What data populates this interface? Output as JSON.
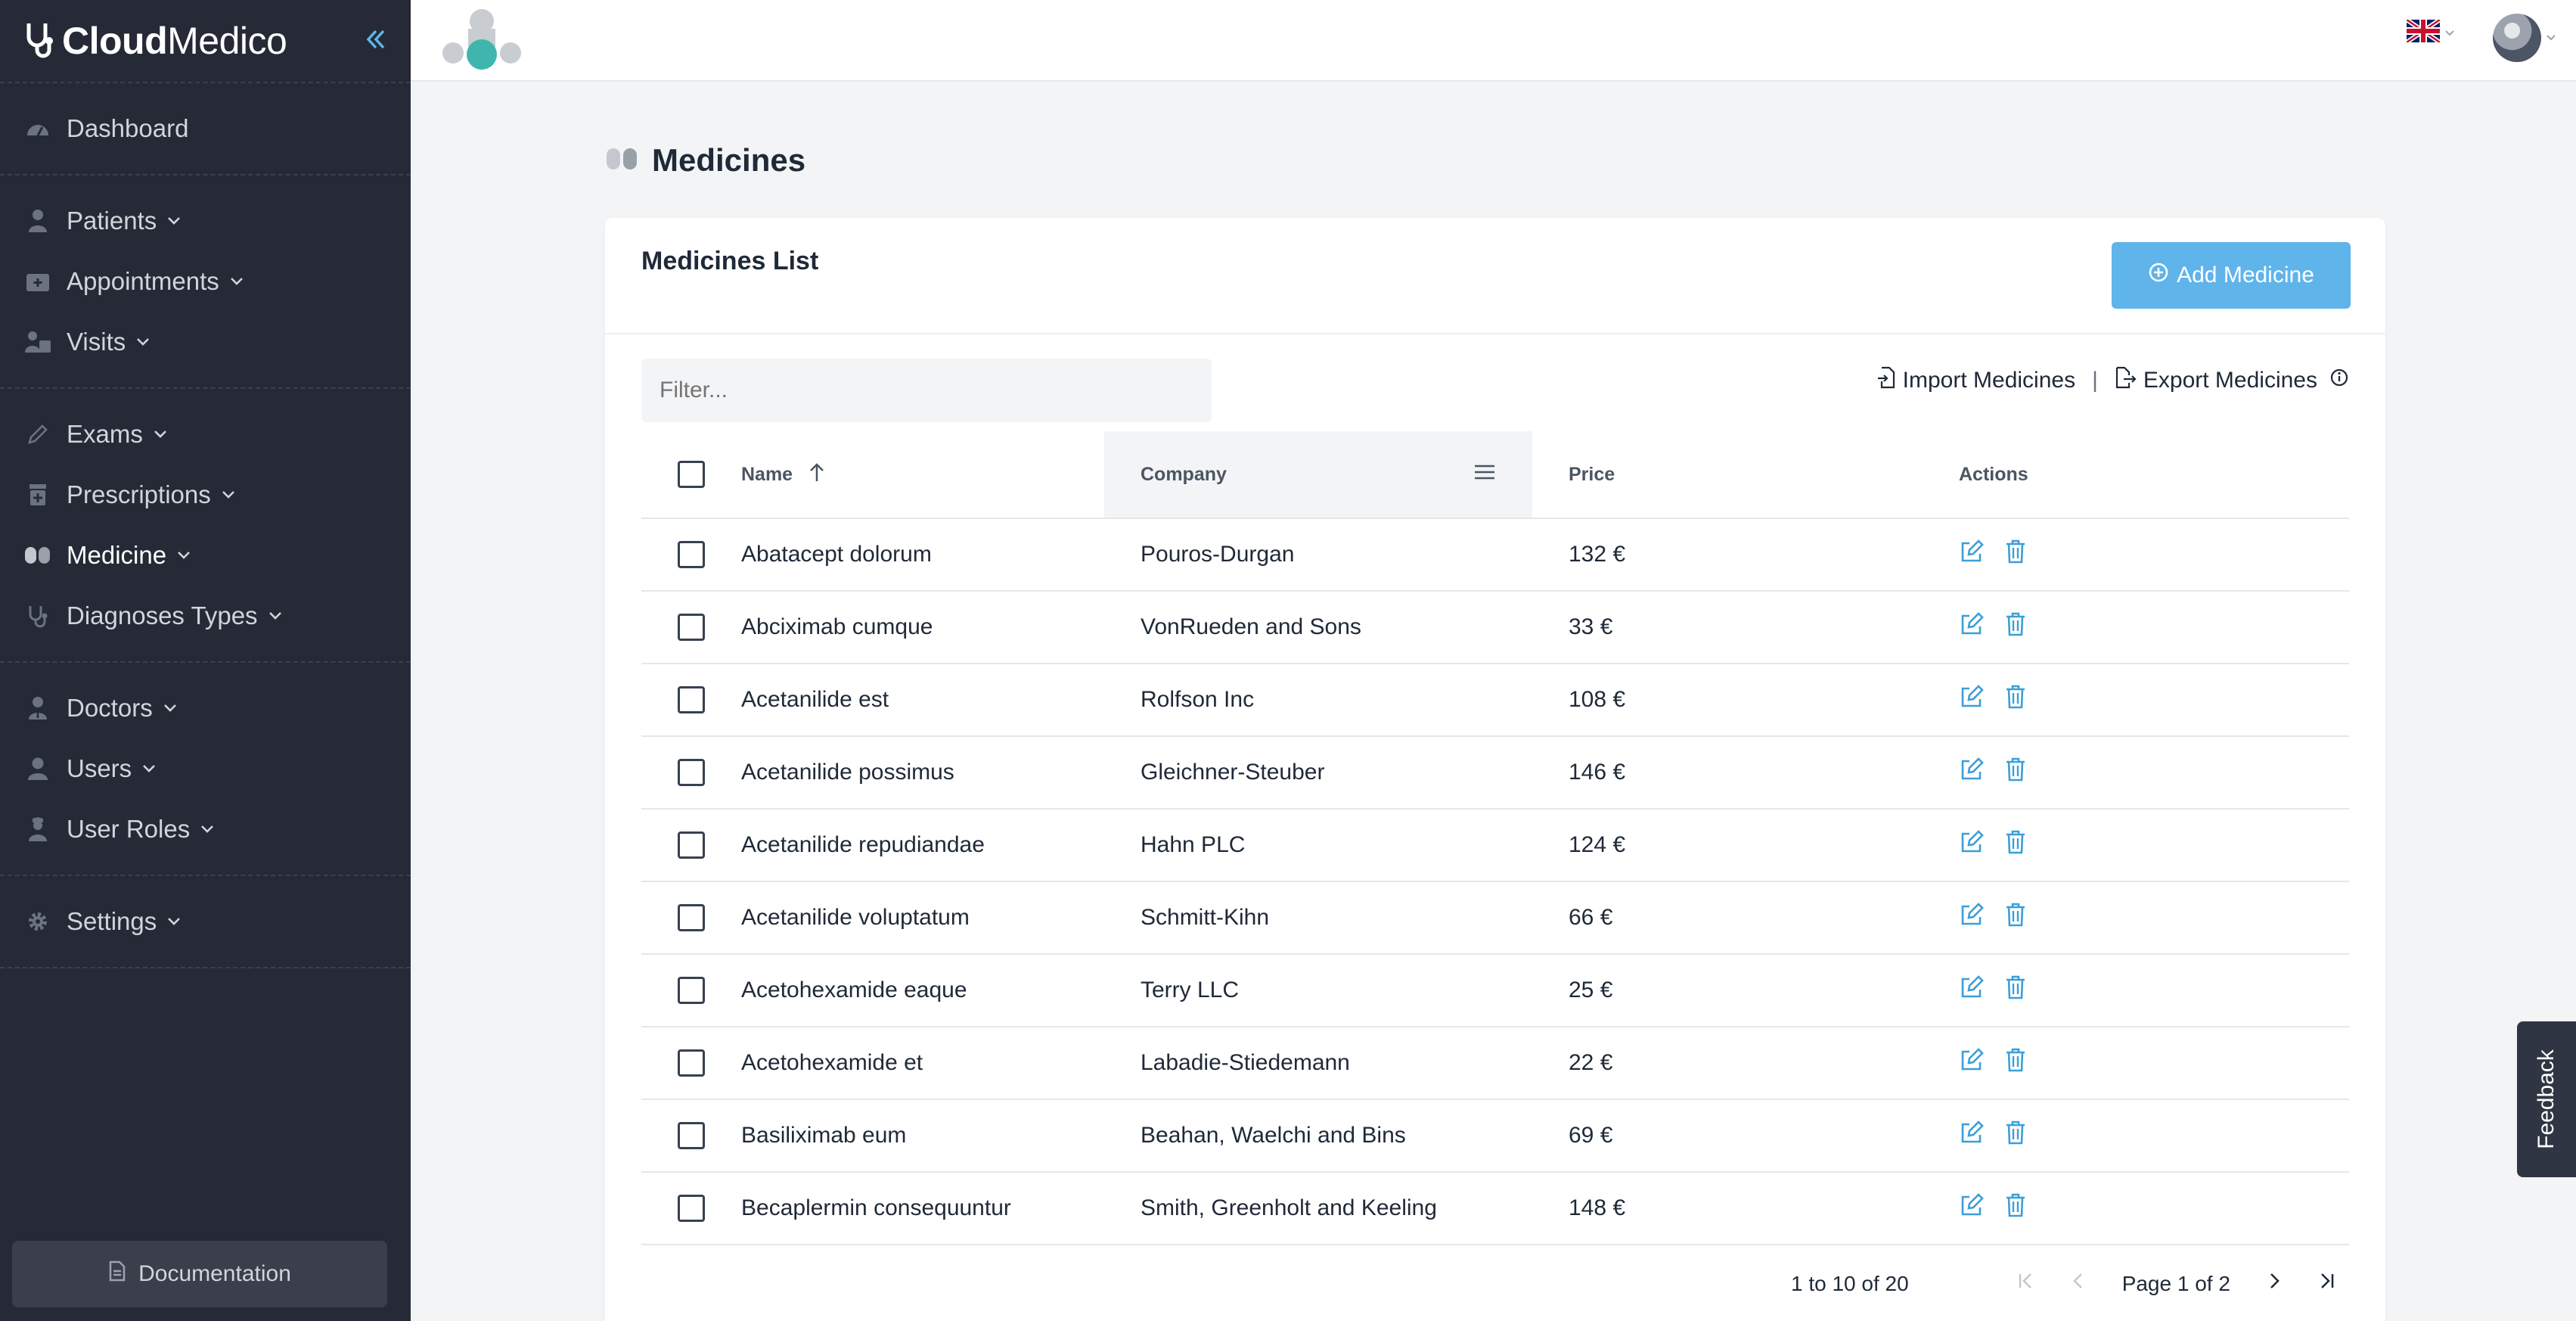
{
  "brand": {
    "name_bold": "Cloud",
    "name_light": "Medico"
  },
  "sidebar": {
    "groups": [
      [
        {
          "label": "Dashboard",
          "icon": "dashboard-icon"
        }
      ],
      [
        {
          "label": "Patients",
          "icon": "patient-icon"
        },
        {
          "label": "Appointments",
          "icon": "calendar-icon"
        },
        {
          "label": "Visits",
          "icon": "visits-icon"
        }
      ],
      [
        {
          "label": "Exams",
          "icon": "pen-icon"
        },
        {
          "label": "Prescriptions",
          "icon": "prescription-icon"
        },
        {
          "label": "Medicine",
          "icon": "pills-icon",
          "active": true
        },
        {
          "label": "Diagnoses Types",
          "icon": "stethoscope-icon"
        }
      ],
      [
        {
          "label": "Doctors",
          "icon": "doctor-icon"
        },
        {
          "label": "Users",
          "icon": "user-icon"
        },
        {
          "label": "User Roles",
          "icon": "user-role-icon"
        }
      ],
      [
        {
          "label": "Settings",
          "icon": "gear-icon"
        }
      ]
    ],
    "documentation_label": "Documentation"
  },
  "page": {
    "title": "Medicines"
  },
  "card": {
    "title": "Medicines List",
    "add_label": "Add Medicine",
    "filter_placeholder": "Filter...",
    "import_label": "Import Medicines",
    "export_label": "Export Medicines",
    "separator": "|"
  },
  "table": {
    "headers": {
      "name": "Name",
      "company": "Company",
      "price": "Price",
      "actions": "Actions"
    },
    "rows": [
      {
        "name": "Abatacept dolorum",
        "company": "Pouros-Durgan",
        "price": "132 €"
      },
      {
        "name": "Abciximab cumque",
        "company": "VonRueden and Sons",
        "price": "33 €"
      },
      {
        "name": "Acetanilide est",
        "company": "Rolfson Inc",
        "price": "108 €"
      },
      {
        "name": "Acetanilide possimus",
        "company": "Gleichner-Steuber",
        "price": "146 €"
      },
      {
        "name": "Acetanilide repudiandae",
        "company": "Hahn PLC",
        "price": "124 €"
      },
      {
        "name": "Acetanilide voluptatum",
        "company": "Schmitt-Kihn",
        "price": "66 €"
      },
      {
        "name": "Acetohexamide eaque",
        "company": "Terry LLC",
        "price": "25 €"
      },
      {
        "name": "Acetohexamide et",
        "company": "Labadie-Stiedemann",
        "price": "22 €"
      },
      {
        "name": "Basiliximab eum",
        "company": "Beahan, Waelchi and Bins",
        "price": "69 €"
      },
      {
        "name": "Becaplermin consequuntur",
        "company": "Smith, Greenholt and Keeling",
        "price": "148 €"
      }
    ]
  },
  "pagination": {
    "range": "1 to 10 of 20",
    "page_text": "Page 1 of 2"
  },
  "feedback_label": "Feedback",
  "colors": {
    "sidebar_bg": "#252a36",
    "accent": "#5fb4ea",
    "action_icon": "#3b9fd8"
  }
}
